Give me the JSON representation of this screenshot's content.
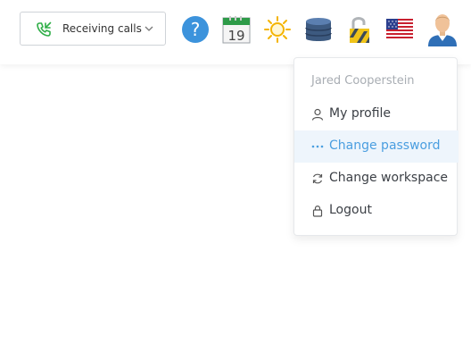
{
  "topbar": {
    "call_status": {
      "label": "Receiving calls",
      "icon": "phone-incoming-icon",
      "color": "#2fae47"
    },
    "calendar_day": "19",
    "icons": [
      "help-icon",
      "calendar-icon",
      "sun-icon",
      "database-icon",
      "lock-icon",
      "us-flag-icon",
      "user-avatar-icon"
    ]
  },
  "user_menu": {
    "user_name": "Jared Cooperstein",
    "items": [
      {
        "label": "My profile",
        "icon": "user-icon",
        "active": false
      },
      {
        "label": "Change password",
        "icon": "dots-icon",
        "active": true
      },
      {
        "label": "Change workspace",
        "icon": "refresh-icon",
        "active": false
      },
      {
        "label": "Logout",
        "icon": "lock-icon",
        "active": false
      }
    ],
    "accent": "#4a9ee0"
  }
}
